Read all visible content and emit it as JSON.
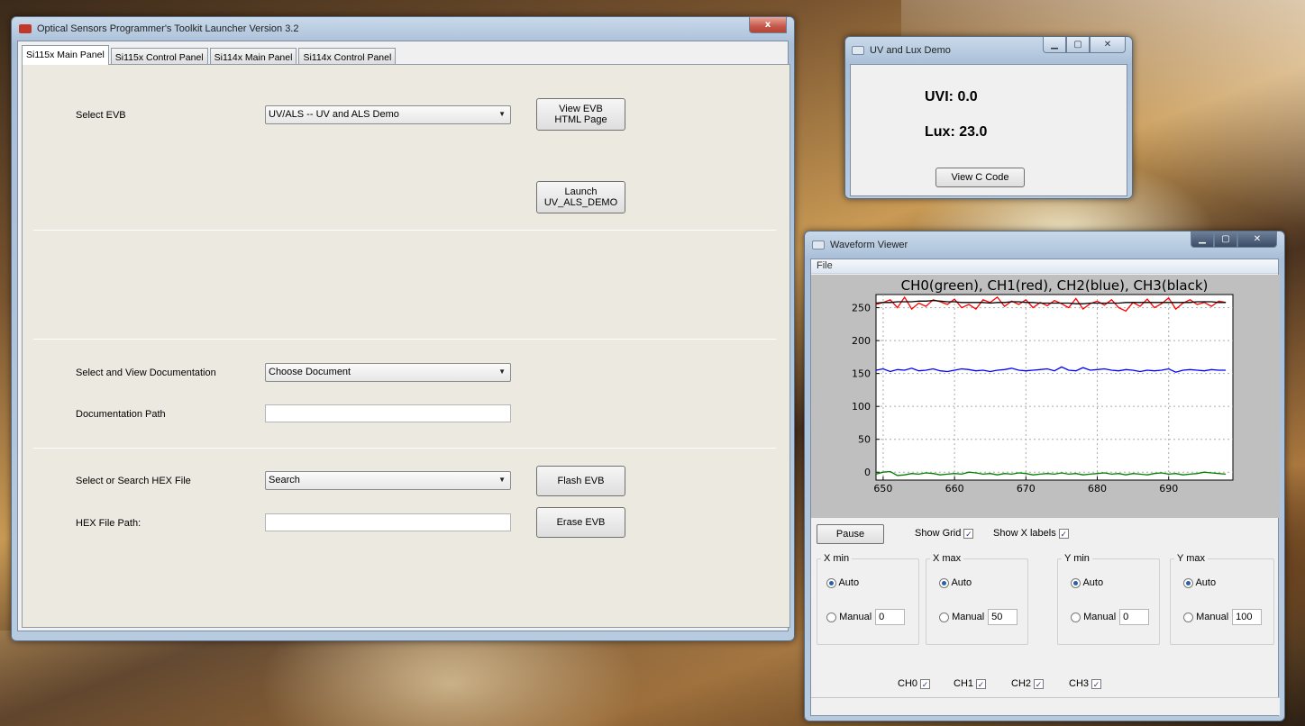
{
  "launcher": {
    "title": "Optical Sensors Programmer's Toolkit Launcher Version 3.2",
    "close_glyph": "x",
    "tabs": [
      "Si115x Main Panel",
      "Si115x Control Panel",
      "Si114x Main Panel",
      "Si114x Control Panel"
    ],
    "select_evb_label": "Select EVB",
    "select_evb_value": "UV/ALS -- UV and ALS Demo",
    "view_evb_button": [
      "View EVB",
      "HTML Page"
    ],
    "launch_button": [
      "Launch",
      "UV_ALS_DEMO"
    ],
    "doc_label": "Select and View Documentation",
    "doc_value": "Choose Document",
    "doc_path_label": "Documentation Path",
    "doc_path_value": "",
    "hex_label": "Select or Search HEX File",
    "hex_value": "Search",
    "flash_button": "Flash EVB",
    "hex_path_label": "HEX File Path:",
    "hex_path_value": "",
    "erase_button": "Erase EVB"
  },
  "uv_demo": {
    "title": "UV and Lux Demo",
    "uvi_text": "UVI: 0.0",
    "lux_text": "Lux: 23.0",
    "view_code_button": "View C Code"
  },
  "waveform": {
    "title": "Waveform Viewer",
    "menu_file": "File",
    "pause_button": "Pause",
    "show_grid_label": "Show Grid",
    "show_x_labels_label": "Show X labels",
    "show_grid": true,
    "show_x_labels": true,
    "groups": [
      {
        "title": "X min",
        "auto_label": "Auto",
        "manual_label": "Manual",
        "manual_value": "0",
        "mode": "auto"
      },
      {
        "title": "X max",
        "auto_label": "Auto",
        "manual_label": "Manual",
        "manual_value": "50",
        "mode": "auto"
      },
      {
        "title": "Y min",
        "auto_label": "Auto",
        "manual_label": "Manual",
        "manual_value": "0",
        "mode": "auto"
      },
      {
        "title": "Y max",
        "auto_label": "Auto",
        "manual_label": "Manual",
        "manual_value": "100",
        "mode": "auto"
      }
    ],
    "channels": [
      {
        "label": "CH0",
        "checked": true
      },
      {
        "label": "CH1",
        "checked": true
      },
      {
        "label": "CH2",
        "checked": true
      },
      {
        "label": "CH3",
        "checked": true
      }
    ]
  },
  "chart_data": {
    "type": "line",
    "title": "CH0(green), CH1(red), CH2(blue), CH3(black)",
    "xlabel": "",
    "ylabel": "",
    "xlim": [
      649,
      699
    ],
    "ylim": [
      -12,
      270
    ],
    "xticks": [
      650,
      660,
      670,
      680,
      690
    ],
    "yticks": [
      0,
      50,
      100,
      150,
      200,
      250
    ],
    "grid": true,
    "x": [
      649,
      650,
      651,
      652,
      653,
      654,
      655,
      656,
      657,
      658,
      659,
      660,
      661,
      662,
      663,
      664,
      665,
      666,
      667,
      668,
      669,
      670,
      671,
      672,
      673,
      674,
      675,
      676,
      677,
      678,
      679,
      680,
      681,
      682,
      683,
      684,
      685,
      686,
      687,
      688,
      689,
      690,
      691,
      692,
      693,
      694,
      695,
      696,
      697,
      698
    ],
    "series": [
      {
        "color": "#008000",
        "values": [
          -3,
          0,
          1,
          -5,
          -4,
          -2,
          -3,
          -1,
          -2,
          -4,
          -3,
          -2,
          -3,
          0,
          -1,
          -3,
          -2,
          -4,
          -2,
          -3,
          -1,
          -2,
          -4,
          -3,
          -2,
          -3,
          -1,
          -3,
          -2,
          -4,
          -3,
          -2,
          -1,
          -3,
          -2,
          -4,
          -2,
          -3,
          -4,
          -2,
          -1,
          -3,
          -2,
          -4,
          -3,
          -2,
          0,
          -1,
          -2,
          -3
        ]
      },
      {
        "color": "#ff0000",
        "values": [
          255,
          258,
          262,
          250,
          266,
          248,
          257,
          252,
          262,
          259,
          255,
          263,
          250,
          255,
          248,
          262,
          258,
          266,
          252,
          260,
          255,
          262,
          250,
          258,
          253,
          261,
          256,
          250,
          264,
          248,
          256,
          260,
          254,
          262,
          250,
          245,
          258,
          252,
          263,
          250,
          256,
          265,
          248,
          257,
          262,
          255,
          258,
          252,
          260,
          258
        ]
      },
      {
        "color": "#0000ff",
        "values": [
          155,
          157,
          153,
          156,
          155,
          158,
          154,
          155,
          157,
          154,
          153,
          155,
          157,
          156,
          154,
          155,
          153,
          155,
          156,
          158,
          155,
          154,
          155,
          156,
          157,
          154,
          160,
          155,
          154,
          159,
          155,
          156,
          157,
          155,
          154,
          156,
          155,
          153,
          155,
          154,
          155,
          157,
          152,
          155,
          156,
          155,
          154,
          156,
          155,
          155
        ]
      },
      {
        "color": "#000000",
        "values": [
          257,
          258,
          258,
          259,
          259,
          259,
          260,
          260,
          261,
          260,
          259,
          259,
          258,
          258,
          258,
          258,
          257,
          258,
          258,
          259,
          259,
          258,
          258,
          257,
          257,
          257,
          257,
          257,
          256,
          256,
          257,
          257,
          257,
          257,
          257,
          258,
          258,
          258,
          258,
          258,
          258,
          258,
          258,
          258,
          258,
          259,
          259,
          259,
          258,
          258
        ]
      }
    ]
  }
}
